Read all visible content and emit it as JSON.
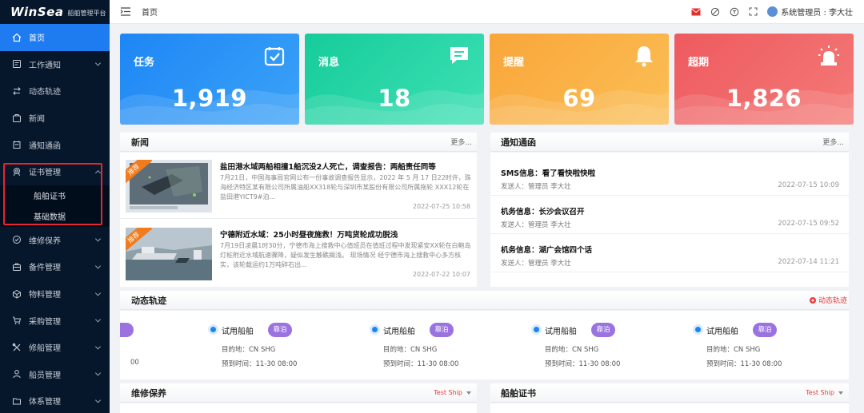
{
  "brand": {
    "logo": "WinSea",
    "subtitle": "船舶管理平台"
  },
  "sidebar": {
    "items": [
      {
        "label": "首页",
        "icon": "home-icon",
        "active": true
      },
      {
        "label": "工作通知",
        "icon": "notice-icon",
        "chevron": true
      },
      {
        "label": "动态轨迹",
        "icon": "track-icon"
      },
      {
        "label": "新闻",
        "icon": "news-icon"
      },
      {
        "label": "通知通函",
        "icon": "circular-icon"
      },
      {
        "label": "证书管理",
        "icon": "certificate-icon",
        "chevron": true,
        "expanded": true,
        "children": [
          {
            "label": "船舶证书"
          },
          {
            "label": "基础数据"
          }
        ]
      },
      {
        "label": "维修保养",
        "icon": "maintenance-icon",
        "chevron": true
      },
      {
        "label": "备件管理",
        "icon": "spare-parts-icon",
        "chevron": true
      },
      {
        "label": "物料管理",
        "icon": "materials-icon",
        "chevron": true
      },
      {
        "label": "采购管理",
        "icon": "cart-icon",
        "chevron": true
      },
      {
        "label": "修船管理",
        "icon": "repair-icon",
        "chevron": true
      },
      {
        "label": "船员管理",
        "icon": "crew-icon",
        "chevron": true
      },
      {
        "label": "体系管理",
        "icon": "system-icon",
        "chevron": true
      }
    ]
  },
  "header": {
    "breadcrumb": "首页",
    "user": "系统管理员 : 李大壮"
  },
  "stats": [
    {
      "label": "任务",
      "value": "1,919",
      "icon": "task-check-icon"
    },
    {
      "label": "消息",
      "value": "18",
      "icon": "message-icon"
    },
    {
      "label": "提醒",
      "value": "69",
      "icon": "bell-icon"
    },
    {
      "label": "超期",
      "value": "1,826",
      "icon": "alarm-icon"
    }
  ],
  "news": {
    "title": "新闻",
    "more": "更多...",
    "items": [
      {
        "tag": "推荐",
        "title": "盐田港水域两船相撞1船沉没2人死亡，调查报告：两船责任同等",
        "desc": "7月21日，中国海事局官网公布一份事故调查报告显示，2022 年 5 月 17 日22时许，珠海经济特区某有限公司所属油船XX318轮与深圳市某股份有限公司所属拖轮 XXX12轮在盐田港YICT9#泊...",
        "date": "2022-07-25 10:58"
      },
      {
        "tag": "推荐",
        "title": "宁德附近水域：25小时昼夜施救！万吨货轮成功脱浅",
        "desc": "7月19日凌晨1时30分，宁德市海上搜救中心值班员在值班过程中发现紧安XX轮在白鲍岛灯桩附近水域航速骤降，疑似发生触礁搁浅。 现场情况 经宁德市海上搜救中心多方核实，该轮载运约1万吨碎石出...",
        "date": "2022-07-22 10:07"
      }
    ]
  },
  "notices": {
    "title": "通知通函",
    "more": "更多...",
    "items": [
      {
        "title": "SMS信息：看了看快啦快啦",
        "sender": "发送人：管理员 李大壮",
        "date": "2022-07-15 10:09"
      },
      {
        "title": "机务信息：长沙会议召开",
        "sender": "发送人：管理员 李大壮",
        "date": "2022-07-15 09:52"
      },
      {
        "title": "机务信息：湖广会馆四个话",
        "sender": "发送人：管理员 李大壮",
        "date": "2022-07-14 11:21"
      }
    ]
  },
  "tracks": {
    "title": "动态轨迹",
    "link": "动态轨迹",
    "partial_eta": "00",
    "items": [
      {
        "name": "试用船舶",
        "status": "靠泊",
        "dest": "目的地：CN SHG",
        "eta": "预到时间：11-30 08:00"
      },
      {
        "name": "试用船舶",
        "status": "靠泊",
        "dest": "目的地：CN SHG",
        "eta": "预到时间：11-30 08:00"
      },
      {
        "name": "试用船舶",
        "status": "靠泊",
        "dest": "目的地：CN SHG",
        "eta": "预到时间：11-30 08:00"
      },
      {
        "name": "试用船舶",
        "status": "靠泊",
        "dest": "目的地：CN SHG",
        "eta": "预到时间：11-30 08:00"
      }
    ]
  },
  "maintenance": {
    "title": "维修保养",
    "ship": "Test Ship"
  },
  "certificates": {
    "title": "船舶证书",
    "ship": "Test Ship"
  },
  "colors": {
    "accent": "#1f7bf0",
    "sidebar": "#06162b",
    "task": "#1e86f5",
    "message": "#16cc9a",
    "reminder": "#f9a63a",
    "overdue": "#ee5a5f",
    "badge": "#9b73e0",
    "highlight": "#e3262f"
  }
}
